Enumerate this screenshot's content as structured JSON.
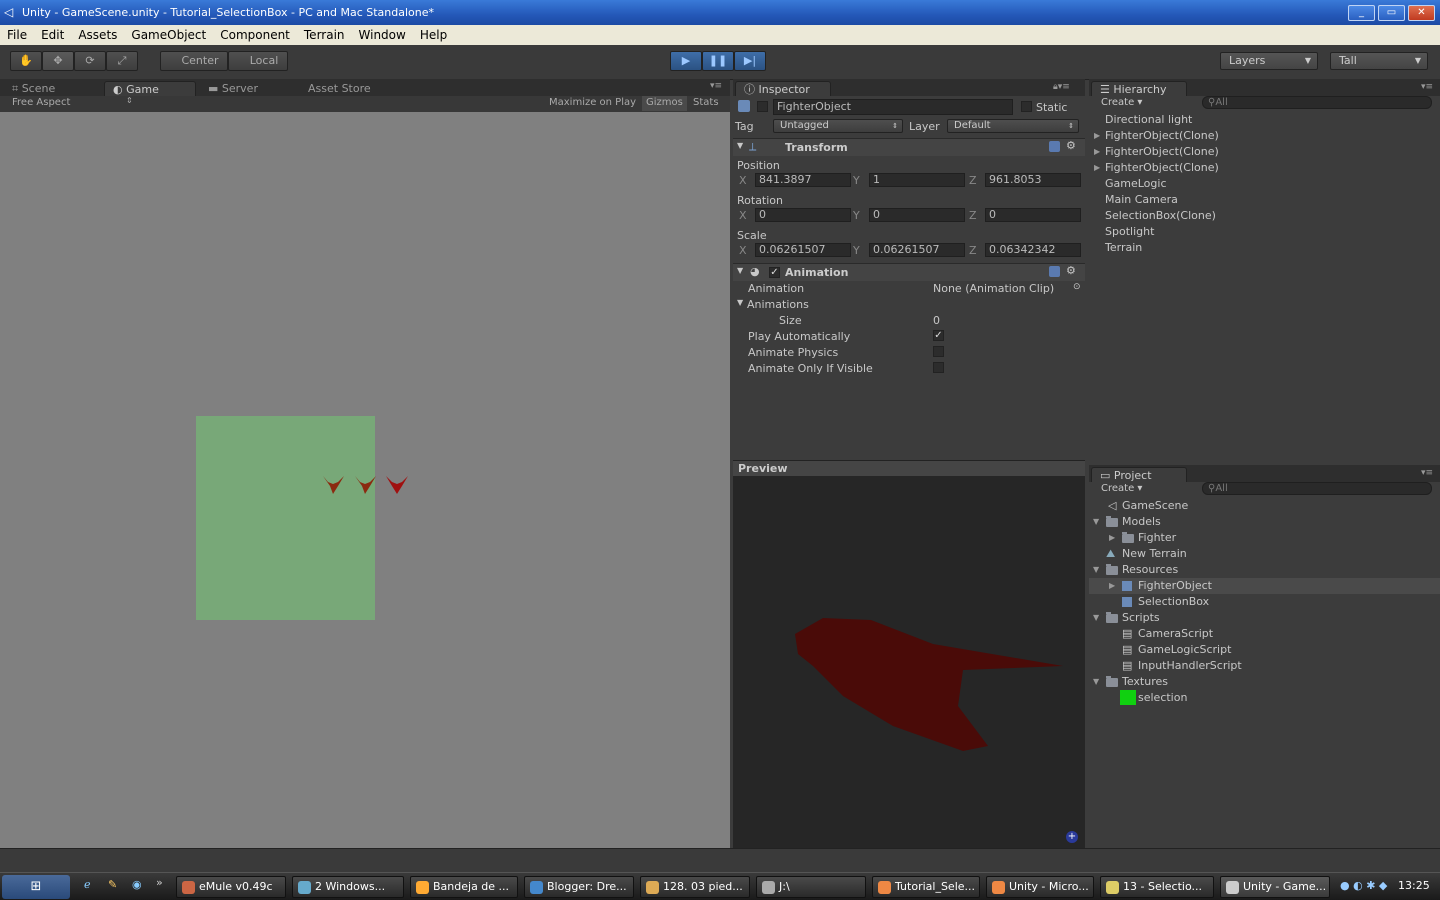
{
  "window": {
    "title": "Unity - GameScene.unity - Tutorial_SelectionBox - PC and Mac Standalone*"
  },
  "menu": [
    "File",
    "Edit",
    "Assets",
    "GameObject",
    "Component",
    "Terrain",
    "Window",
    "Help"
  ],
  "toolbar": {
    "pivot": "Center",
    "space": "Local",
    "layers": "Layers",
    "layout": "Tall"
  },
  "tabs": {
    "scene": "Scene",
    "game": "Game",
    "server": "Server",
    "asset_store": "Asset Store",
    "inspector": "Inspector",
    "hierarchy": "Hierarchy",
    "project": "Project"
  },
  "game": {
    "aspect": "Free Aspect",
    "maximize": "Maximize on Play",
    "gizmos": "Gizmos",
    "stats": "Stats",
    "selection_color": "#78a878",
    "fighter_color": "#8b1a10"
  },
  "inspector": {
    "object_name": "FighterObject",
    "static": "Static",
    "tag_label": "Tag",
    "tag": "Untagged",
    "layer_label": "Layer",
    "layer": "Default",
    "transform": {
      "title": "Transform",
      "position": "Position",
      "rotation": "Rotation",
      "scale": "Scale",
      "pos": {
        "x": "841.3897",
        "y": "1",
        "z": "961.8053"
      },
      "rot": {
        "x": "0",
        "y": "0",
        "z": "0"
      },
      "scl": {
        "x": "0.06261507",
        "y": "0.06261507",
        "z": "0.06342342"
      },
      "x": "X",
      "y": "Y",
      "z": "Z"
    },
    "animation": {
      "title": "Animation",
      "clip_label": "Animation",
      "clip": "None (Animation Clip)",
      "animations": "Animations",
      "size_label": "Size",
      "size": "0",
      "play_auto": "Play Automatically",
      "physics": "Animate Physics",
      "visible": "Animate Only If Visible",
      "play_auto_checked": true,
      "physics_checked": false,
      "visible_checked": false
    },
    "preview": "Preview"
  },
  "hierarchy": {
    "create": "Create",
    "search": "All",
    "items": [
      "Directional light",
      "FighterObject(Clone)",
      "FighterObject(Clone)",
      "FighterObject(Clone)",
      "GameLogic",
      "Main Camera",
      "SelectionBox(Clone)",
      "Spotlight",
      "Terrain"
    ]
  },
  "project": {
    "create": "Create",
    "search": "All",
    "items": [
      "GameScene",
      "Models",
      "Fighter",
      "New Terrain",
      "Resources",
      "FighterObject",
      "SelectionBox",
      "Scripts",
      "CameraScript",
      "GameLogicScript",
      "InputHandlerScript",
      "Textures",
      "selection"
    ]
  },
  "taskbar": {
    "items": [
      "eMule v0.49c",
      "2 Windows...",
      "Bandeja de ...",
      "Blogger: Dre...",
      "128. 03 pied...",
      "J:\\",
      "Tutorial_Sele...",
      "Unity - Micro...",
      "13 - Selectio...",
      "Unity - Game..."
    ],
    "time": "13:25"
  }
}
